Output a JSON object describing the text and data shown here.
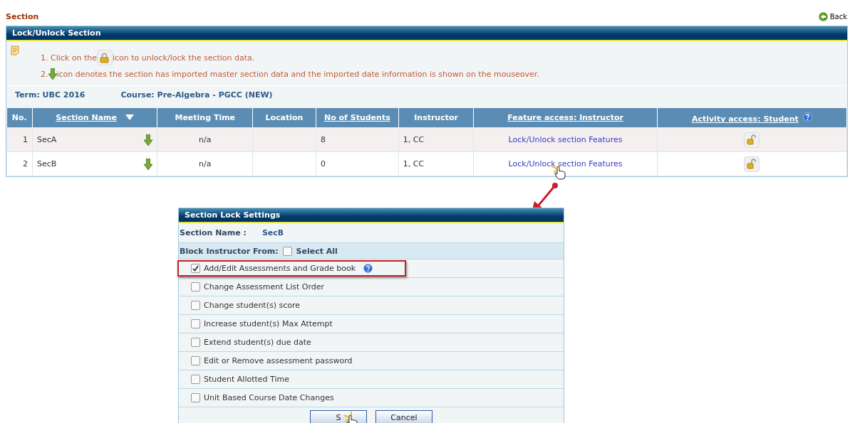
{
  "page": {
    "title": "Section",
    "back": "Back"
  },
  "panel": {
    "title": "Lock/Unlock Section",
    "instructions": [
      {
        "kind": "lock",
        "before": "1. Click on the ",
        "after": "icon to unlock/lock the section data."
      },
      {
        "kind": "arrow",
        "before": "2. ",
        "after": "icon denotes the section has imported master section data and the imported date information is shown on the mouseover."
      }
    ],
    "term": "Term: UBC 2016",
    "course": "Course: Pre-Algebra - PGCC (NEW)"
  },
  "table": {
    "columns": [
      {
        "label": "No.",
        "link": false
      },
      {
        "label": "Section Name",
        "link": true,
        "sorted": true
      },
      {
        "label": "Meeting Time",
        "link": false
      },
      {
        "label": "Location",
        "link": false
      },
      {
        "label": "No of Students",
        "link": true
      },
      {
        "label": "Instructor",
        "link": false
      },
      {
        "label": "Feature access: Instructor",
        "link": true
      },
      {
        "label": "Activity access: Student",
        "link": true,
        "help": true
      }
    ],
    "rows": [
      {
        "no": "1",
        "name": "SecA",
        "meeting": "n/a",
        "students": "8",
        "instructor": "1, CC",
        "feature": "Lock/Unlock section Features",
        "hovered": false
      },
      {
        "no": "2",
        "name": "SecB",
        "meeting": "n/a",
        "students": "0",
        "instructor": "1, CC",
        "feature": "Lock/Unlock section Features",
        "hovered": true
      }
    ]
  },
  "dialog": {
    "title": "Section Lock Settings",
    "section_label": "Section Name :",
    "section_value": "SecB",
    "block_label": "Block Instructor From:",
    "select_all": {
      "label": "Select All",
      "checked": false
    },
    "options": [
      {
        "label": "Add/Edit Assessments and Grade book",
        "checked": true,
        "help": true,
        "highlighted": true
      },
      {
        "label": "Change Assessment List Order",
        "checked": false,
        "help": false,
        "highlighted": false
      },
      {
        "label": "Change student(s) score",
        "checked": false,
        "help": false,
        "highlighted": false
      },
      {
        "label": "Increase student(s) Max Attempt",
        "checked": false,
        "help": false,
        "highlighted": false
      },
      {
        "label": "Extend student(s) due date",
        "checked": false,
        "help": false,
        "highlighted": false
      },
      {
        "label": "Edit or Remove assessment password",
        "checked": false,
        "help": false,
        "highlighted": false
      },
      {
        "label": "Student Allotted Time",
        "checked": false,
        "help": false,
        "highlighted": false
      },
      {
        "label": "Unit Based Course Date Changes",
        "checked": false,
        "help": false,
        "highlighted": false
      }
    ],
    "buttons": [
      {
        "label": "S",
        "hovered": true
      },
      {
        "label": "Cancel",
        "hovered": false
      }
    ]
  }
}
